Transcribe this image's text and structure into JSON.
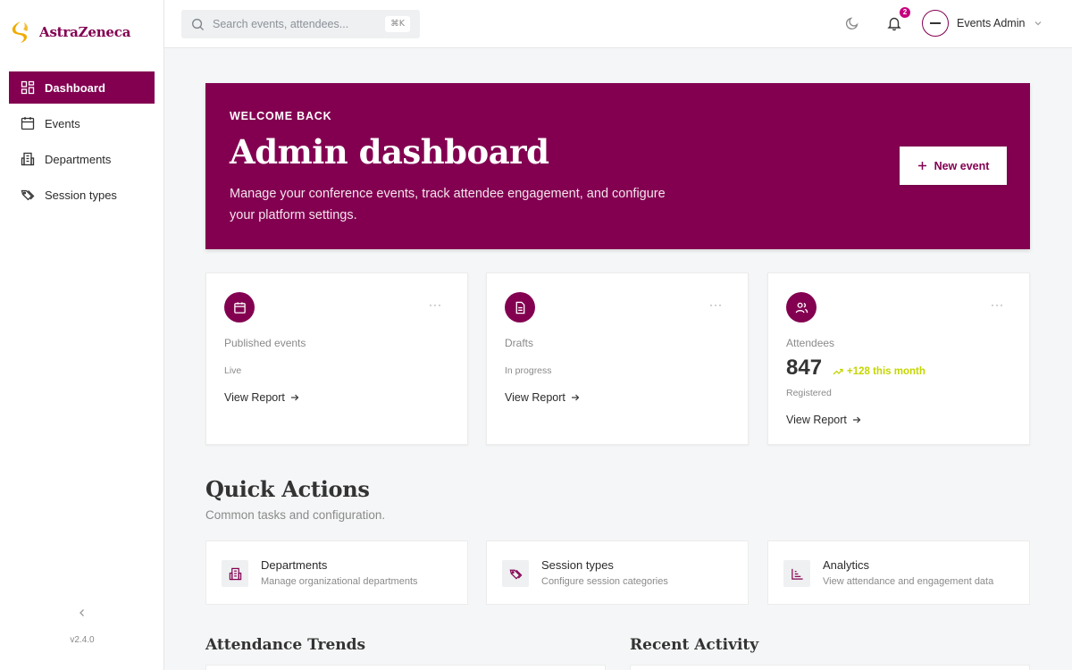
{
  "brand": {
    "name": "AstraZeneca"
  },
  "sidebar": {
    "items": [
      {
        "label": "Dashboard",
        "icon": "dashboard-icon",
        "active": true
      },
      {
        "label": "Events",
        "icon": "calendar-icon",
        "active": false
      },
      {
        "label": "Departments",
        "icon": "building-icon",
        "active": false
      },
      {
        "label": "Session types",
        "icon": "tags-icon",
        "active": false
      }
    ],
    "version": "v2.4.0"
  },
  "topbar": {
    "search_placeholder": "Search events, attendees...",
    "search_shortcut": "⌘K",
    "notifications_count": "2",
    "user_name": "Events Admin"
  },
  "hero": {
    "kicker": "WELCOME BACK",
    "title": "Admin dashboard",
    "description": "Manage your conference events, track attendee engagement, and configure your platform settings.",
    "button_label": "New event"
  },
  "stats": [
    {
      "label": "Published events",
      "sub": "Live",
      "link": "View Report",
      "icon": "calendar-icon"
    },
    {
      "label": "Drafts",
      "sub": "In progress",
      "link": "View Report",
      "icon": "document-icon"
    },
    {
      "label": "Attendees",
      "value": "847",
      "trend": "+128 this month",
      "sub": "Registered",
      "link": "View Report",
      "icon": "users-icon"
    }
  ],
  "quick_actions": {
    "title": "Quick Actions",
    "subtitle": "Common tasks and configuration.",
    "items": [
      {
        "name": "Departments",
        "desc": "Manage organizational departments",
        "icon": "building-icon"
      },
      {
        "name": "Session types",
        "desc": "Configure session categories",
        "icon": "tags-icon"
      },
      {
        "name": "Analytics",
        "desc": "View attendance and engagement data",
        "icon": "bar-chart-icon"
      }
    ]
  },
  "sections": {
    "attendance_trends": "Attendance Trends",
    "recent_activity": "Recent Activity"
  },
  "colors": {
    "brand": "#830051",
    "accent": "#c4d600",
    "badge": "#c6007e",
    "logo": "#f0ab00"
  }
}
